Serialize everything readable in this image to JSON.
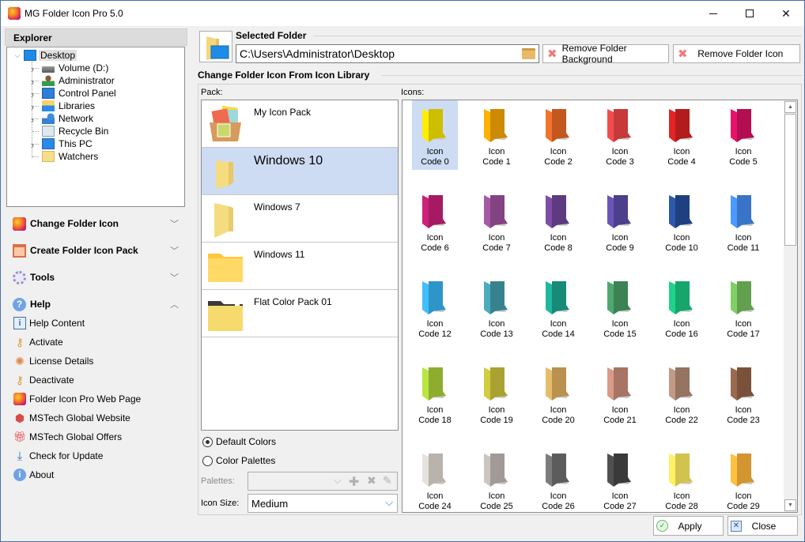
{
  "window": {
    "title": "MG Folder Icon Pro 5.0",
    "controls": [
      "minimize",
      "maximize",
      "close"
    ]
  },
  "explorer": {
    "header": "Explorer",
    "root": {
      "label": "Desktop",
      "icon": "desktop-icon",
      "expanded": true,
      "selected": true
    },
    "children": [
      {
        "label": "Volume (D:)",
        "icon": "drive-icon",
        "expandable": true
      },
      {
        "label": "Administrator",
        "icon": "user-icon",
        "expandable": true
      },
      {
        "label": "Control Panel",
        "icon": "control-panel-icon",
        "expandable": true
      },
      {
        "label": "Libraries",
        "icon": "libraries-icon",
        "expandable": true
      },
      {
        "label": "Network",
        "icon": "network-icon",
        "expandable": true
      },
      {
        "label": "Recycle Bin",
        "icon": "recycle-bin-icon",
        "expandable": false
      },
      {
        "label": "This PC",
        "icon": "computer-icon",
        "expandable": true
      },
      {
        "label": "Watchers",
        "icon": "folder-icon",
        "expandable": false
      }
    ]
  },
  "sections": [
    {
      "label": "Change Folder Icon",
      "icon": "app-logo-icon",
      "expanded": false
    },
    {
      "label": "Create Folder Icon Pack",
      "icon": "package-box-icon",
      "expanded": false
    },
    {
      "label": "Tools",
      "icon": "gear-icon",
      "expanded": false
    },
    {
      "label": "Help",
      "icon": "help-icon",
      "expanded": true
    }
  ],
  "help_items": [
    {
      "label": "Help Content",
      "icon": "book-info-icon"
    },
    {
      "label": "Activate",
      "icon": "key-icon"
    },
    {
      "label": "License Details",
      "icon": "license-badge-icon"
    },
    {
      "label": "Deactivate",
      "icon": "key-remove-icon"
    },
    {
      "label": "Folder Icon Pro Web Page",
      "icon": "app-logo-icon"
    },
    {
      "label": "MSTech Global Website",
      "icon": "mstech-logo-icon"
    },
    {
      "label": "MSTech Global Offers",
      "icon": "gift-icon"
    },
    {
      "label": "Check for Update",
      "icon": "download-icon"
    },
    {
      "label": "About",
      "icon": "info-icon"
    }
  ],
  "selected_folder": {
    "title": "Selected Folder",
    "path": "C:\\Users\\Administrator\\Desktop",
    "remove_background_label": "Remove Folder Background",
    "remove_icon_label": "Remove Folder Icon"
  },
  "library": {
    "title": "Change Folder Icon From Icon Library",
    "pack_label": "Pack:",
    "icons_label": "Icons:",
    "packs": [
      {
        "label": "My Icon Pack",
        "selected": false
      },
      {
        "label": "Windows 10",
        "selected": true
      },
      {
        "label": "Windows 7",
        "selected": false
      },
      {
        "label": "Windows 11",
        "selected": false
      },
      {
        "label": "Flat Color Pack 01",
        "selected": false
      }
    ],
    "color_mode": {
      "default_colors_label": "Default Colors",
      "color_palettes_label": "Color Palettes",
      "selected": "Default Colors"
    },
    "palettes_label": "Palettes:",
    "palettes_value": "",
    "icon_size_label": "Icon Size:",
    "icon_size_value": "Medium",
    "icons_scroll_fraction": 0.0,
    "icons": [
      {
        "label": "Icon Code 0",
        "line1": "Icon",
        "line2": "Code 0",
        "front": "#ffee00",
        "back": "#cdbe00",
        "selected": true
      },
      {
        "label": "Icon Code 1",
        "line1": "Icon",
        "line2": "Code 1",
        "front": "#ffb000",
        "back": "#cc8a05"
      },
      {
        "label": "Icon Code 2",
        "line1": "Icon",
        "line2": "Code 2",
        "front": "#f2752c",
        "back": "#c4561f"
      },
      {
        "label": "Icon Code 3",
        "line1": "Icon",
        "line2": "Code 3",
        "front": "#f24c4c",
        "back": "#c63a3a"
      },
      {
        "label": "Icon Code 4",
        "line1": "Icon",
        "line2": "Code 4",
        "front": "#e42424",
        "back": "#b31c1c"
      },
      {
        "label": "Icon Code 5",
        "line1": "Icon",
        "line2": "Code 5",
        "front": "#e8126a",
        "back": "#b30e52"
      },
      {
        "label": "Icon Code 6",
        "line1": "Icon",
        "line2": "Code 6",
        "front": "#cf207a",
        "back": "#a51a62"
      },
      {
        "label": "Icon Code 7",
        "line1": "Icon",
        "line2": "Code 7",
        "front": "#a65aa6",
        "back": "#834383"
      },
      {
        "label": "Icon Code 8",
        "line1": "Icon",
        "line2": "Code 8",
        "front": "#7e4ea6",
        "back": "#5e3a80"
      },
      {
        "label": "Icon Code 9",
        "line1": "Icon",
        "line2": "Code 9",
        "front": "#6a56b8",
        "back": "#4c3f8c"
      },
      {
        "label": "Icon Code 10",
        "line1": "Icon",
        "line2": "Code 10",
        "front": "#2c5aaa",
        "back": "#1e4080"
      },
      {
        "label": "Icon Code 11",
        "line1": "Icon",
        "line2": "Code 11",
        "front": "#4a9aff",
        "back": "#3a74c8"
      },
      {
        "label": "Icon Code 12",
        "line1": "Icon",
        "line2": "Code 12",
        "front": "#40bfff",
        "back": "#2e95c8"
      },
      {
        "label": "Icon Code 13",
        "line1": "Icon",
        "line2": "Code 13",
        "front": "#4aacbe",
        "back": "#38828f"
      },
      {
        "label": "Icon Code 14",
        "line1": "Icon",
        "line2": "Code 14",
        "front": "#1fb8a0",
        "back": "#178a78"
      },
      {
        "label": "Icon Code 15",
        "line1": "Icon",
        "line2": "Code 15",
        "front": "#4fa870",
        "back": "#3c8254"
      },
      {
        "label": "Icon Code 16",
        "line1": "Icon",
        "line2": "Code 16",
        "front": "#1ed38a",
        "back": "#16a66b"
      },
      {
        "label": "Icon Code 17",
        "line1": "Icon",
        "line2": "Code 17",
        "front": "#82cf68",
        "back": "#62a04e"
      },
      {
        "label": "Icon Code 18",
        "line1": "Icon",
        "line2": "Code 18",
        "front": "#b8e640",
        "back": "#8ead30"
      },
      {
        "label": "Icon Code 19",
        "line1": "Icon",
        "line2": "Code 19",
        "front": "#d2cc40",
        "back": "#a9a232"
      },
      {
        "label": "Icon Code 20",
        "line1": "Icon",
        "line2": "Code 20",
        "front": "#e6be6a",
        "back": "#b8924e"
      },
      {
        "label": "Icon Code 21",
        "line1": "Icon",
        "line2": "Code 21",
        "front": "#d99a88",
        "back": "#a87464"
      },
      {
        "label": "Icon Code 22",
        "line1": "Icon",
        "line2": "Code 22",
        "front": "#c29a86",
        "back": "#957462"
      },
      {
        "label": "Icon Code 23",
        "line1": "Icon",
        "line2": "Code 23",
        "front": "#9a6a4e",
        "back": "#7a523c"
      },
      {
        "label": "Icon Code 24",
        "line1": "Icon",
        "line2": "Code 24",
        "front": "#e6e2de",
        "back": "#b9b2ad"
      },
      {
        "label": "Icon Code 25",
        "line1": "Icon",
        "line2": "Code 25",
        "front": "#ccc4c0",
        "back": "#a29a96"
      },
      {
        "label": "Icon Code 26",
        "line1": "Icon",
        "line2": "Code 26",
        "front": "#7c7c7c",
        "back": "#5c5c5c"
      },
      {
        "label": "Icon Code 27",
        "line1": "Icon",
        "line2": "Code 27",
        "front": "#505050",
        "back": "#3a3a3a"
      },
      {
        "label": "Icon Code 28",
        "line1": "Icon",
        "line2": "Code 28",
        "front": "#fff066",
        "back": "#d2c24e"
      },
      {
        "label": "Icon Code 29",
        "line1": "Icon",
        "line2": "Code 29",
        "front": "#ffc040",
        "back": "#d29530"
      }
    ]
  },
  "footer": {
    "apply_label": "Apply",
    "close_label": "Close"
  },
  "colors": {
    "selection": "#cddcf3",
    "window_border": "#4a6fa5",
    "remove_x": "#f07a7a"
  }
}
